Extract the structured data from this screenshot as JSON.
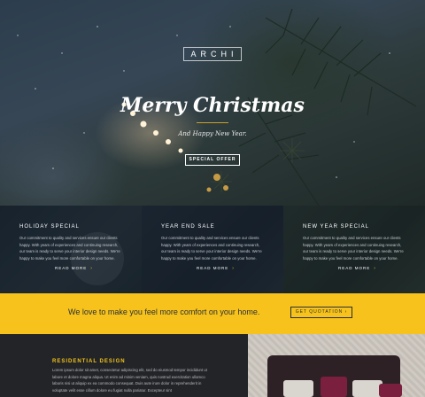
{
  "hero": {
    "logo": "ARCHI",
    "title": "Merry Christmas",
    "subtitle": "And Happy New Year.",
    "button_label": "SPECIAL OFFER"
  },
  "features": [
    {
      "title": "HOLIDAY SPECIAL",
      "text": "Our commitment to quality and services ensure our clients happy. With years of experiences and continuing research, our team is ready to serve your interior design needs. We're happy to make you feel more comfortable on your home.",
      "more_label": "READ MORE"
    },
    {
      "title": "YEAR END SALE",
      "text": "Our commitment to quality and services ensure our clients happy. With years of experiences and continuing research, our team is ready to serve your interior design needs. We're happy to make you feel more comfortable on your home.",
      "more_label": "READ MORE"
    },
    {
      "title": "NEW YEAR SPECIAL",
      "text": "Our commitment to quality and services ensure our clients happy. With years of experiences and continuing research, our team is ready to serve your interior design needs. We're happy to make you feel more comfortable on your home.",
      "more_label": "READ MORE"
    }
  ],
  "cta": {
    "text": "We love to make you feel more comfort on your home.",
    "button_label": "GET QUOTATION"
  },
  "residential": {
    "title": "RESIDENTIAL DESIGN",
    "text": "Lorem ipsum dolor sit amet, consectetur adipiscing elit, sed do eiusmod tempor incididunt ut labore et dolore magna aliqua. Ut enim ad minim veniam, quis nostrud exercitation ullamco laboris nisi ut aliquip ex ea commodo consequat. Duis aute irure dolor in reprehenderit in voluptate velit esse cillum dolore eu fugiat nulla pariatur. Excepteur sint"
  },
  "colors": {
    "accent": "#f6c21b",
    "dark": "#222428"
  },
  "icons": {
    "more_arrow": "chevron-right-icon",
    "cta_arrow": "chevron-right-icon"
  }
}
